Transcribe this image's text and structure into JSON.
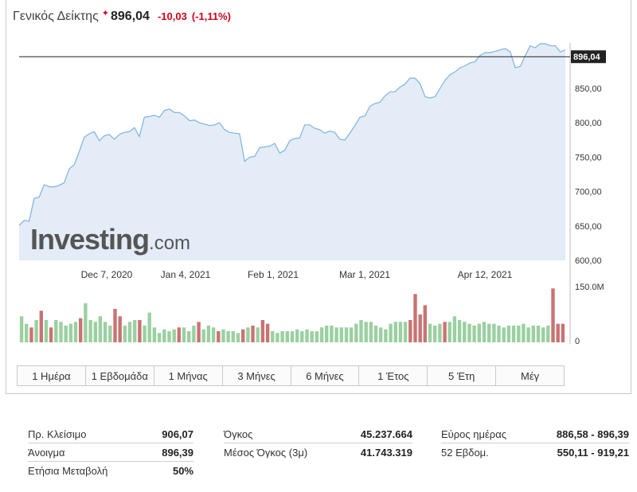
{
  "header": {
    "name": "Γενικός Δείκτης",
    "price": "896,04",
    "change": "-10,03",
    "change_pct": "(-1,11%)",
    "color_down": "#d0021b"
  },
  "logo": {
    "main": "Investing",
    "suffix": ".com"
  },
  "price_axis": {
    "last_label": "896,04",
    "ticks": [
      {
        "v": 850,
        "label": "850,00"
      },
      {
        "v": 800,
        "label": "800,00"
      },
      {
        "v": 750,
        "label": "750,00"
      },
      {
        "v": 700,
        "label": "700,00"
      },
      {
        "v": 650,
        "label": "650,00"
      },
      {
        "v": 600,
        "label": "600,00"
      }
    ]
  },
  "volume_axis": {
    "ticks": [
      "150.0M",
      "0"
    ]
  },
  "tabs": [
    "1 Ημέρα",
    "1 Εβδομάδα",
    "1 Μήνας",
    "3 Μήνες",
    "6 Μήνες",
    "1 Έτος",
    "5 Έτη",
    "Μέγ"
  ],
  "stats": {
    "col1": [
      {
        "label": "Πρ. Κλείσιμο",
        "value": "906,07"
      },
      {
        "label": "Άνοιγμα",
        "value": "896,39"
      },
      {
        "label": "Ετήσια Μεταβολή",
        "value": "50%"
      }
    ],
    "col2": [
      {
        "label": "Όγκος",
        "value": "45.237.664"
      },
      {
        "label": "Μέσος Όγκος (3μ)",
        "value": "41.743.319"
      }
    ],
    "col3": [
      {
        "label": "Εύρος ημέρας",
        "value": "886,58 - 896,39"
      },
      {
        "label": "52 Εβδομ.",
        "value": "550,11 - 919,21"
      }
    ]
  },
  "chart_data": {
    "type": "area",
    "title": "",
    "xlabel": "",
    "ylabel": "",
    "ylim": [
      600,
      916
    ],
    "x_tick_labels": [
      "Dec 7, 2020",
      "Jan 4, 2021",
      "Feb 1, 2021",
      "Mar 1, 2021",
      "Apr 12, 2021"
    ],
    "last_value": 896.04,
    "colors": {
      "line": "#7fb2dc",
      "fill": "#e3ecf7",
      "up": "#9bd0a1",
      "down": "#c97373"
    },
    "series": [
      {
        "values": [
          651,
          658,
          657,
          690,
          692,
          710,
          707,
          707,
          709,
          713,
          733,
          739,
          758,
          779,
          784,
          787,
          774,
          781,
          783,
          776,
          783,
          786,
          787,
          793,
          780,
          808,
          809,
          811,
          808,
          818,
          820,
          815,
          815,
          810,
          803,
          804,
          800,
          798,
          796,
          797,
          800,
          790,
          786,
          785,
          784,
          744,
          750,
          751,
          764,
          765,
          766,
          770,
          756,
          760,
          774,
          777,
          778,
          797,
          797,
          792,
          790,
          785,
          788,
          786,
          776,
          775,
          785,
          796,
          808,
          810,
          824,
          828,
          830,
          839,
          845,
          845,
          852,
          856,
          865,
          865,
          857,
          838,
          836,
          838,
          850,
          862,
          870,
          874,
          880,
          883,
          887,
          889,
          898,
          902,
          902,
          904,
          906,
          908,
          903,
          880,
          882,
          898,
          912,
          909,
          915,
          915,
          912,
          912,
          903,
          906
        ]
      }
    ],
    "volume": {
      "ylim": [
        0,
        150
      ],
      "values": [
        70,
        50,
        40,
        60,
        85,
        60,
        40,
        60,
        55,
        45,
        50,
        55,
        65,
        105,
        60,
        55,
        70,
        55,
        45,
        90,
        70,
        45,
        55,
        60,
        60,
        45,
        80,
        40,
        25,
        35,
        30,
        35,
        40,
        40,
        30,
        45,
        55,
        35,
        45,
        40,
        30,
        35,
        30,
        30,
        25,
        35,
        40,
        45,
        40,
        60,
        50,
        30,
        25,
        30,
        30,
        30,
        35,
        30,
        35,
        30,
        30,
        40,
        45,
        45,
        40,
        40,
        40,
        40,
        50,
        60,
        55,
        55,
        45,
        40,
        35,
        50,
        55,
        55,
        55,
        60,
        130,
        75,
        100,
        50,
        45,
        50,
        55,
        55,
        70,
        60,
        55,
        50,
        45,
        50,
        55,
        50,
        50,
        45,
        40,
        45,
        45,
        45,
        50,
        40,
        45,
        45,
        40,
        45,
        145,
        50,
        50
      ],
      "down": [
        false,
        false,
        true,
        false,
        true,
        false,
        true,
        false,
        false,
        false,
        false,
        false,
        true,
        false,
        false,
        false,
        false,
        false,
        false,
        true,
        true,
        false,
        false,
        false,
        true,
        false,
        false,
        false,
        false,
        false,
        false,
        false,
        true,
        false,
        false,
        false,
        true,
        false,
        false,
        false,
        true,
        false,
        false,
        false,
        false,
        true,
        false,
        true,
        false,
        true,
        true,
        false,
        false,
        false,
        false,
        false,
        false,
        false,
        false,
        false,
        false,
        false,
        false,
        false,
        false,
        false,
        false,
        false,
        false,
        false,
        false,
        false,
        false,
        false,
        false,
        false,
        false,
        false,
        false,
        true,
        true,
        true,
        true,
        false,
        false,
        false,
        true,
        false,
        false,
        false,
        false,
        false,
        false,
        false,
        false,
        false,
        false,
        false,
        false,
        false,
        false,
        false,
        false,
        false,
        false,
        false,
        false,
        false,
        true,
        true,
        true
      ]
    }
  }
}
